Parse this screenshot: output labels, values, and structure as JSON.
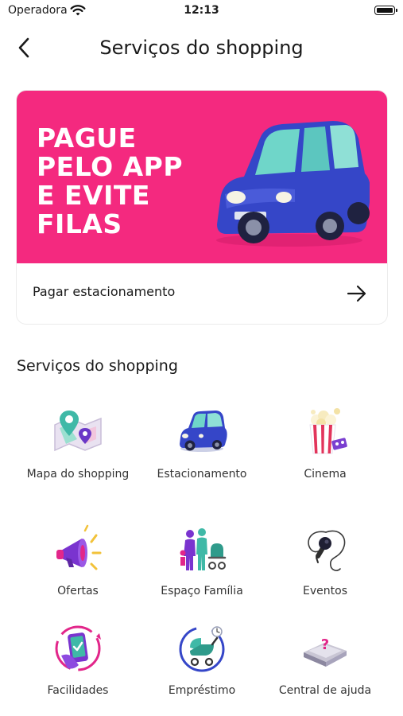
{
  "status_bar": {
    "carrier": "Operadora",
    "time": "12:13"
  },
  "header": {
    "title": "Serviços do shopping"
  },
  "banner": {
    "headline": "PAGUE\nPELO APP\nE EVITE\nFILAS",
    "action_label": "Pagar estacionamento",
    "background_color": "#f4297f"
  },
  "section": {
    "title": "Serviços do shopping"
  },
  "services": [
    {
      "label": "Mapa do shopping",
      "icon": "map-icon"
    },
    {
      "label": "Estacionamento",
      "icon": "car-icon"
    },
    {
      "label": "Cinema",
      "icon": "popcorn-icon"
    },
    {
      "label": "Ofertas",
      "icon": "megaphone-icon"
    },
    {
      "label": "Espaço Família",
      "icon": "family-icon"
    },
    {
      "label": "Eventos",
      "icon": "microphone-icon"
    },
    {
      "label": "Facilidades",
      "icon": "phone-icon"
    },
    {
      "label": "Empréstimo",
      "icon": "stroller-icon"
    },
    {
      "label": "Central de ajuda",
      "icon": "help-box-icon"
    }
  ]
}
